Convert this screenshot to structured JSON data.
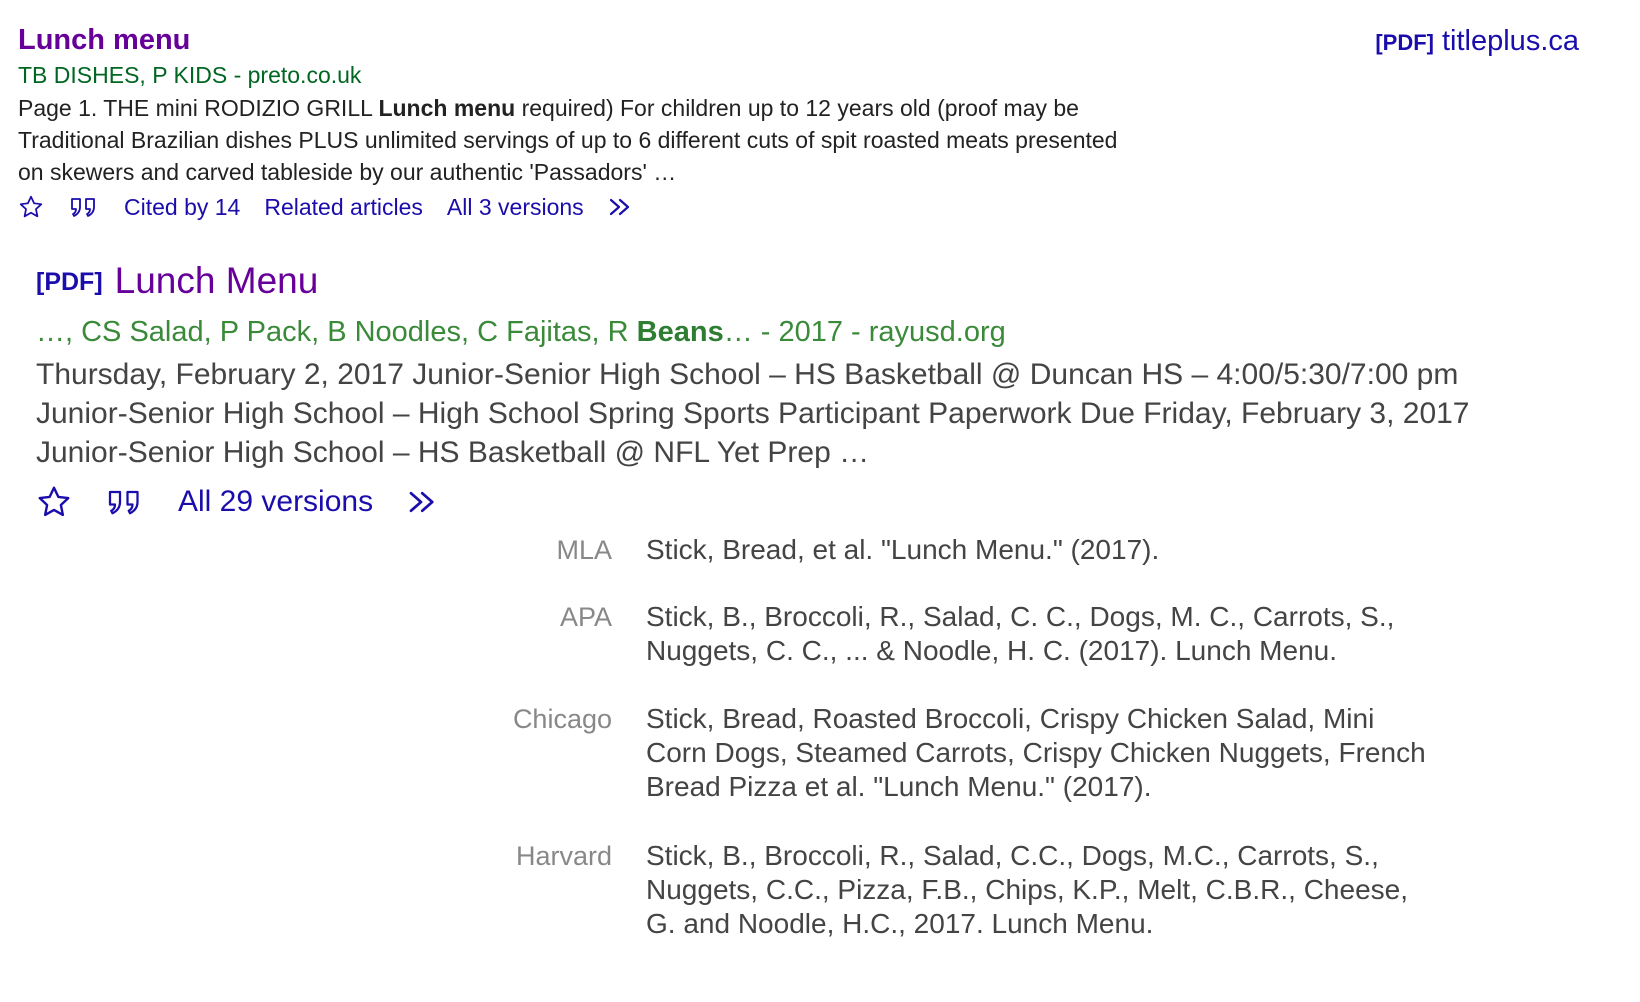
{
  "result1": {
    "title": "Lunch menu",
    "side_pdf_tag": "[PDF]",
    "side_domain": "titleplus.ca",
    "meta": "TB DISHES, P KIDS - preto.co.uk",
    "snippet_pre": "Page 1. THE mini RODIZIO GRILL ",
    "snippet_bold": "Lunch menu",
    "snippet_post": " required) For children up to 12 years old (proof may be Traditional Brazilian dishes PLUS unlimited servings of up to 6 different cuts of spit roasted meats presented on skewers and carved tableside by our authentic 'Passadors' …",
    "cited_by": "Cited by 14",
    "related": "Related articles",
    "versions": "All 3 versions"
  },
  "result2": {
    "pdf_tag": "[PDF]",
    "title": "Lunch Menu",
    "meta_pre": "…, CS Salad, P Pack, B Noodles, C Fajitas, R ",
    "meta_bold": "Beans",
    "meta_post": "… - 2017 - rayusd.org",
    "snippet": "Thursday, February 2, 2017 Junior-Senior High School – HS Basketball @ Duncan HS – 4:00/5:30/7:00 pm Junior-Senior High School – High School Spring Sports Participant Paperwork Due Friday, February 3, 2017 Junior-Senior High School – HS Basketball @ NFL Yet Prep …",
    "versions": "All 29 versions"
  },
  "citations": [
    {
      "style": "MLA",
      "text": "Stick, Bread, et al. \"Lunch Menu.\" (2017)."
    },
    {
      "style": "APA",
      "text": "Stick, B., Broccoli, R., Salad, C. C., Dogs, M. C., Carrots, S., Nuggets, C. C., ... & Noodle, H. C. (2017). Lunch Menu."
    },
    {
      "style": "Chicago",
      "text": "Stick, Bread, Roasted Broccoli, Crispy Chicken Salad, Mini Corn Dogs, Steamed Carrots, Crispy Chicken Nuggets, French Bread Pizza et al. \"Lunch Menu.\" (2017)."
    },
    {
      "style": "Harvard",
      "text": "Stick, B., Broccoli, R., Salad, C.C., Dogs, M.C., Carrots, S., Nuggets, C.C., Pizza, F.B., Chips, K.P., Melt, C.B.R., Cheese, G. and Noodle, H.C., 2017. Lunch Menu."
    }
  ],
  "icons": {
    "save": "star-outline-icon",
    "cite": "quote-icon",
    "more": "double-chevron-right-icon"
  },
  "colors": {
    "link": "#1a0dab",
    "visited_title": "#660099",
    "meta_green": "#006621",
    "citation_text": "#444444",
    "citation_label": "#888888"
  }
}
